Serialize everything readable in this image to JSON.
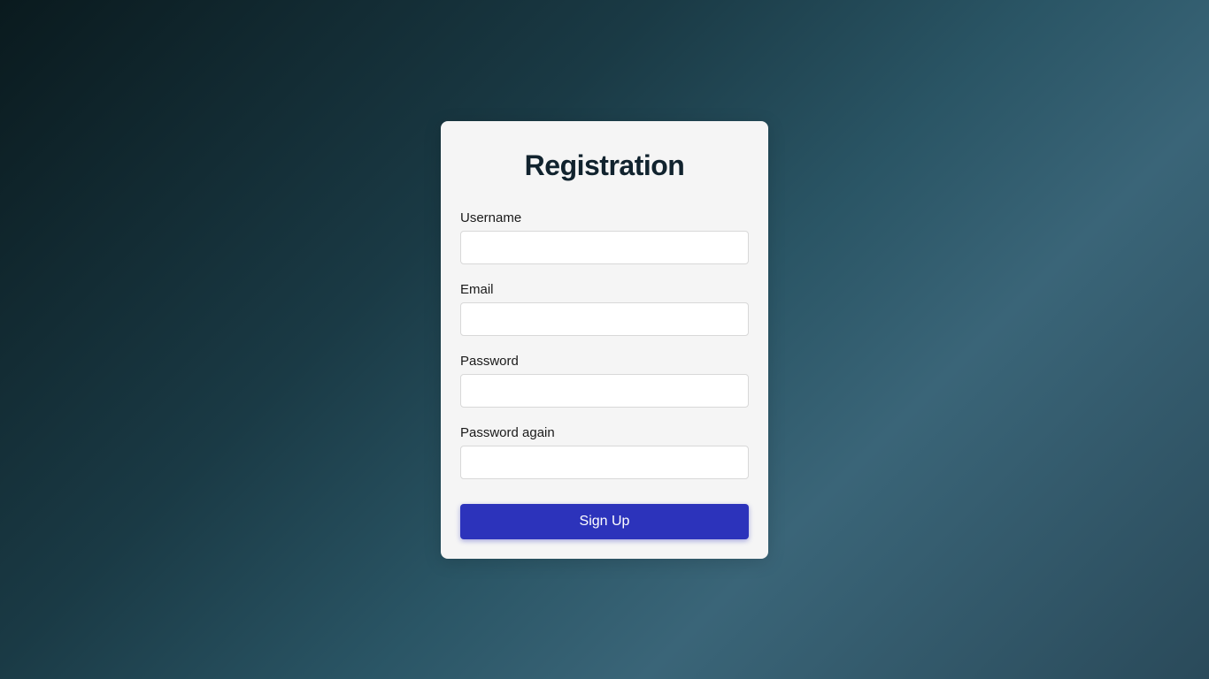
{
  "form": {
    "title": "Registration",
    "fields": {
      "username": {
        "label": "Username",
        "value": ""
      },
      "email": {
        "label": "Email",
        "value": ""
      },
      "password": {
        "label": "Password",
        "value": ""
      },
      "password_again": {
        "label": "Password again",
        "value": ""
      }
    },
    "submit_label": "Sign Up"
  }
}
